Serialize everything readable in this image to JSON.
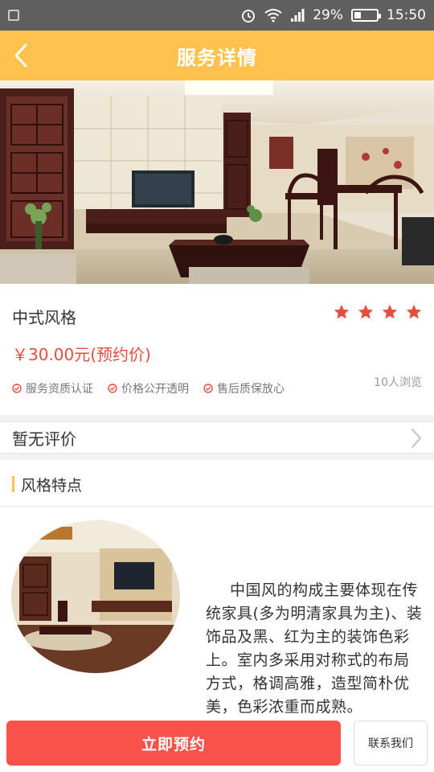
{
  "status_bar": {
    "battery": "29%",
    "battery_level": 0.29,
    "time": "15:50"
  },
  "header": {
    "title": "服务详情"
  },
  "service": {
    "name": "中式风格",
    "rating_stars": 4,
    "price": "￥30.00元(预约价)",
    "features": [
      "服务资质认证",
      "价格公开透明",
      "售后质保放心"
    ],
    "views": "10人浏览"
  },
  "reviews": {
    "label": "暂无评价"
  },
  "style_section": {
    "heading": "风格特点",
    "description": "中国风的构成主要体现在传统家具(多为明清家具为主)、装饰品及黑、红为主的装饰色彩上。室内多采用对称式的布局方式，格调高雅，造型简朴优美，色彩浓重而成熟。"
  },
  "actions": {
    "book_label": "立即预约",
    "contact_label": "联系我们"
  },
  "colors": {
    "accent": "#ffc24e",
    "price": "#e94b3c",
    "book_button": "#f8524a"
  }
}
